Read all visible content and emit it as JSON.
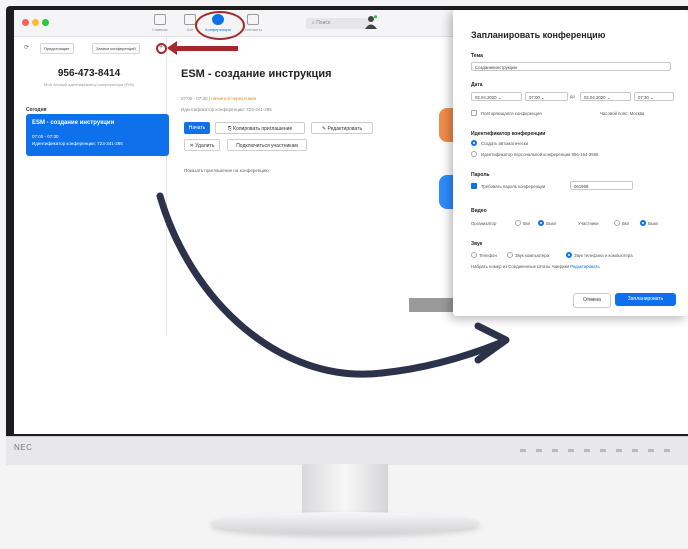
{
  "monitor": {
    "brand": "NEC"
  },
  "app": {
    "nav": [
      {
        "label": "Главная",
        "active": false
      },
      {
        "label": "Чат",
        "active": false
      },
      {
        "label": "Конференции",
        "active": true
      },
      {
        "label": "Контакты",
        "active": false
      }
    ],
    "search_placeholder": "Поиск"
  },
  "sidebar": {
    "tab_upcoming": "Предстоящие",
    "tab_recorded": "Записи конференций",
    "pmi": "956-473-8414",
    "pmi_sub": "Мой личный идентификатор конференции (PMI)",
    "today_label": "Сегодня",
    "meeting": {
      "title": "ESM - создание инструкции",
      "time": "07:00 - 07:30",
      "meeting_id": "Идентификатор конференции: 723-341-285"
    }
  },
  "detail": {
    "title": "ESM - создание инструкция",
    "time": "07:00 - 07:30",
    "starts_in": "начнется через 6 мин",
    "meeting_id": "Идентификатор конференции: 723-341-285",
    "buttons": {
      "start": "Начать",
      "copy_invite": "Копировать приглашение",
      "edit": "Редактировать",
      "delete": "Удалить",
      "join_participants": "Подключиться участникам"
    },
    "show_invitation": "Показать приглашение на конференцию"
  },
  "dialog": {
    "title": "Запланировать конференцию",
    "topic_label": "Тема",
    "topic_value": "Созданиеинструкции",
    "date_label": "Дата",
    "start_date": "02.04.2020",
    "start_time": "07:00",
    "to_word": "до",
    "end_date": "02.04.2020",
    "end_time": "07:30",
    "recurring": "Повторяющаяся конференция",
    "timezone": "Часовой пояс: Москва",
    "meeting_id_label": "Идентификатор конференции",
    "id_auto": "Создать автоматически",
    "id_personal": "Идентификатор персональной конференции 956-164-3585",
    "password_label": "Пароль",
    "password_require": "Требовать пароль конференции",
    "password_value": "061998",
    "video_label": "Видео",
    "video_host": "Организатор",
    "video_participant": "Участники",
    "on": "Вкл",
    "off": "Выкл",
    "audio_label": "Звук",
    "audio_phone": "Телефон",
    "audio_computer": "Звук компьютера",
    "audio_both": "Звук телефона и компьютера",
    "dialin_text": "Набрать номер из Соединенные Штаты Америки",
    "dialin_edit": "Редактировать",
    "cancel": "Отмена",
    "schedule": "Запланировать"
  },
  "colors": {
    "accent": "#0e71eb",
    "highlight": "#a32a2a",
    "curve_arrow": "#2b3249"
  }
}
